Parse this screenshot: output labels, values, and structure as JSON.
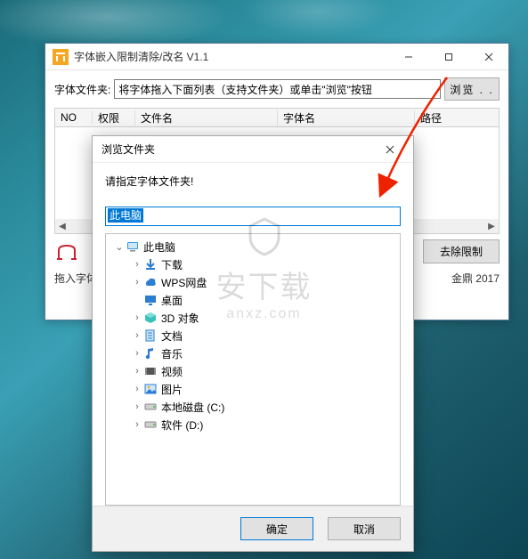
{
  "main": {
    "title": "字体嵌入限制清除/改名 V1.1",
    "folder_label": "字体文件夹:",
    "folder_placeholder": "将字体拖入下面列表（支持文件夹）或单击\"浏览\"按钮",
    "browse_btn": "浏览 . .",
    "columns": {
      "no": "NO",
      "perm": "权限",
      "file": "文件名",
      "font": "字体名",
      "path": "路径"
    },
    "remove_btn": "去除限制",
    "hint": "拖入字体",
    "author": "金鼎  2017"
  },
  "dialog": {
    "title": "浏览文件夹",
    "message": "请指定字体文件夹!",
    "selected": "此电脑",
    "tree": [
      {
        "depth": 0,
        "toggle": "expanded",
        "icon": "pc",
        "label": "此电脑"
      },
      {
        "depth": 1,
        "toggle": "collapsed",
        "icon": "downloads",
        "label": "下载"
      },
      {
        "depth": 1,
        "toggle": "collapsed",
        "icon": "wps",
        "label": "WPS网盘"
      },
      {
        "depth": 1,
        "toggle": "none",
        "icon": "desktop",
        "label": "桌面"
      },
      {
        "depth": 1,
        "toggle": "collapsed",
        "icon": "3d",
        "label": "3D 对象"
      },
      {
        "depth": 1,
        "toggle": "collapsed",
        "icon": "documents",
        "label": "文档"
      },
      {
        "depth": 1,
        "toggle": "collapsed",
        "icon": "music",
        "label": "音乐"
      },
      {
        "depth": 1,
        "toggle": "collapsed",
        "icon": "videos",
        "label": "视频"
      },
      {
        "depth": 1,
        "toggle": "collapsed",
        "icon": "pictures",
        "label": "图片"
      },
      {
        "depth": 1,
        "toggle": "collapsed",
        "icon": "disk",
        "label": "本地磁盘 (C:)"
      },
      {
        "depth": 1,
        "toggle": "collapsed",
        "icon": "disk",
        "label": "软件 (D:)"
      }
    ],
    "ok": "确定",
    "cancel": "取消"
  },
  "watermark": {
    "title": "安下载",
    "sub": "anxz.com"
  }
}
